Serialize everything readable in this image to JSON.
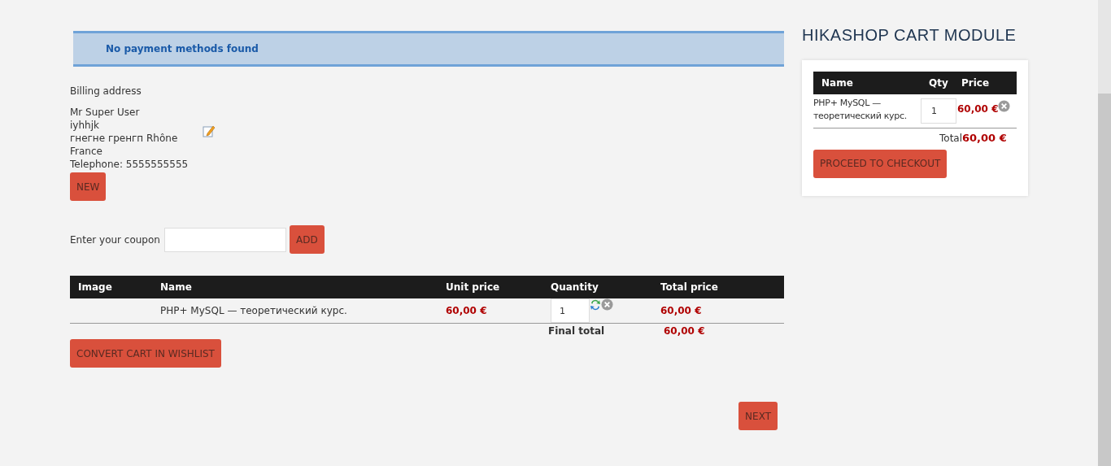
{
  "alert": {
    "text": "No payment methods found"
  },
  "billing": {
    "title": "Billing address",
    "lines": [
      "Mr Super User",
      "iyhhjk",
      "гнегне гренгп Rhône",
      "France",
      "Telephone: 5555555555"
    ],
    "new_button": "NEW"
  },
  "coupon": {
    "label": "Enter your coupon",
    "button": "ADD"
  },
  "cart_table": {
    "columns": [
      "Image",
      "Name",
      "Unit price",
      "Quantity",
      "Total price"
    ],
    "rows": [
      {
        "name": "PHP+ MySQL — теоретический курс.",
        "unit_price": "60,00 €",
        "quantity": "1",
        "total_price": "60,00 €"
      }
    ],
    "final_total_label": "Final total",
    "final_total": "60,00 €"
  },
  "wishlist_button": "CONVERT CART IN WISHLIST",
  "next_button": "NEXT",
  "module": {
    "title": "HIKASHOP CART MODULE",
    "columns": [
      "Name",
      "Qty",
      "Price"
    ],
    "rows": [
      {
        "name": "PHP+ MySQL — теоретический курс.",
        "quantity": "1",
        "price": "60,00 €"
      }
    ],
    "total_label": "Total",
    "total": "60,00 €",
    "checkout_button": "PROCEED TO CHECKOUT"
  }
}
